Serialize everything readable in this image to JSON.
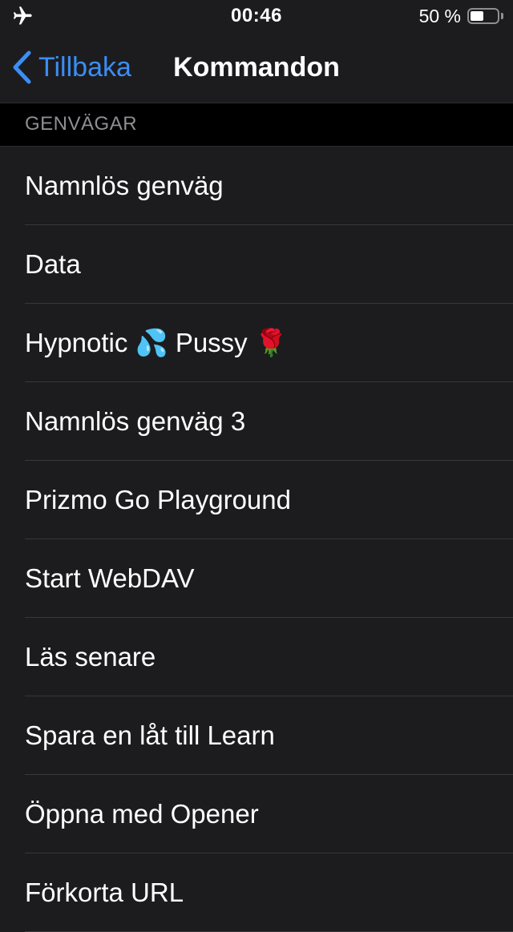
{
  "status_bar": {
    "airplane_icon": "airplane-icon",
    "time": "00:46",
    "battery_percent": "50 %",
    "battery_level": 0.5
  },
  "nav": {
    "back_label": "Tillbaka",
    "title": "Kommandon"
  },
  "section": {
    "header": "GENVÄGAR"
  },
  "shortcuts": [
    {
      "label": "Namnlös genväg"
    },
    {
      "label": "Data"
    },
    {
      "label": "Hypnotic 💦 Pussy 🌹"
    },
    {
      "label": "Namnlös genväg 3"
    },
    {
      "label": "Prizmo Go Playground"
    },
    {
      "label": "Start WebDAV"
    },
    {
      "label": "Läs senare"
    },
    {
      "label": "Spara en låt till Learn"
    },
    {
      "label": "Öppna med Opener"
    },
    {
      "label": "Förkorta URL"
    }
  ],
  "colors": {
    "accent": "#3b8ef5",
    "background": "#1c1c1e",
    "section_header_bg": "#000000",
    "secondary_text": "#8e8e93"
  }
}
